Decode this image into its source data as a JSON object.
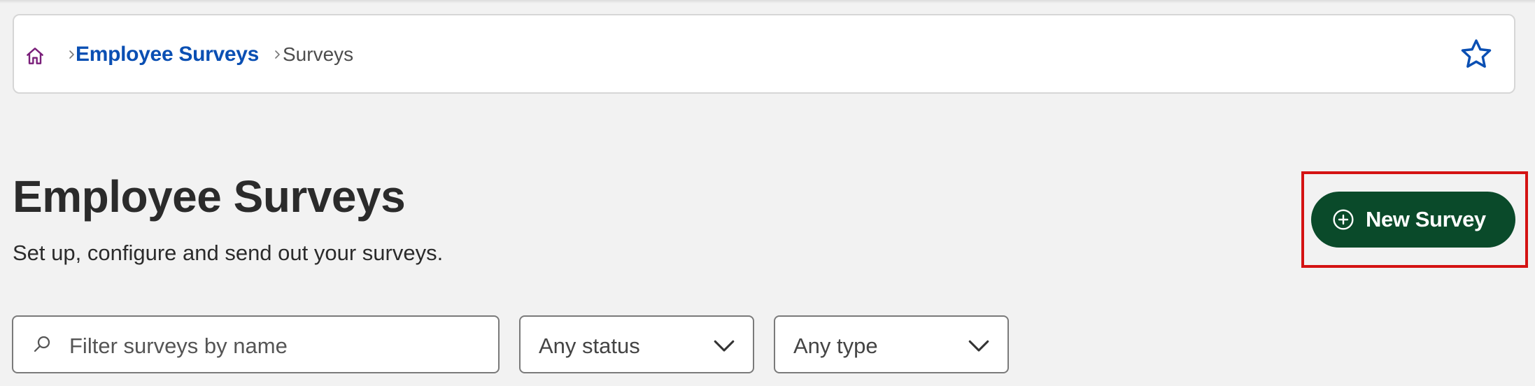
{
  "breadcrumb": {
    "home_icon": "home-icon",
    "parent_label": "Employee Surveys",
    "current_label": "Surveys",
    "favorite_icon": "star-icon"
  },
  "header": {
    "title": "Employee Surveys",
    "subtitle": "Set up, configure and send out your surveys."
  },
  "actions": {
    "new_survey_label": "New Survey",
    "new_survey_icon": "plus-circle-icon"
  },
  "filters": {
    "search_placeholder": "Filter surveys by name",
    "status_selected": "Any status",
    "type_selected": "Any type"
  },
  "colors": {
    "link_blue": "#0a4fb3",
    "primary_green": "#0a4a2a",
    "highlight_red": "#d41313",
    "home_purple": "#7a1f7a"
  }
}
